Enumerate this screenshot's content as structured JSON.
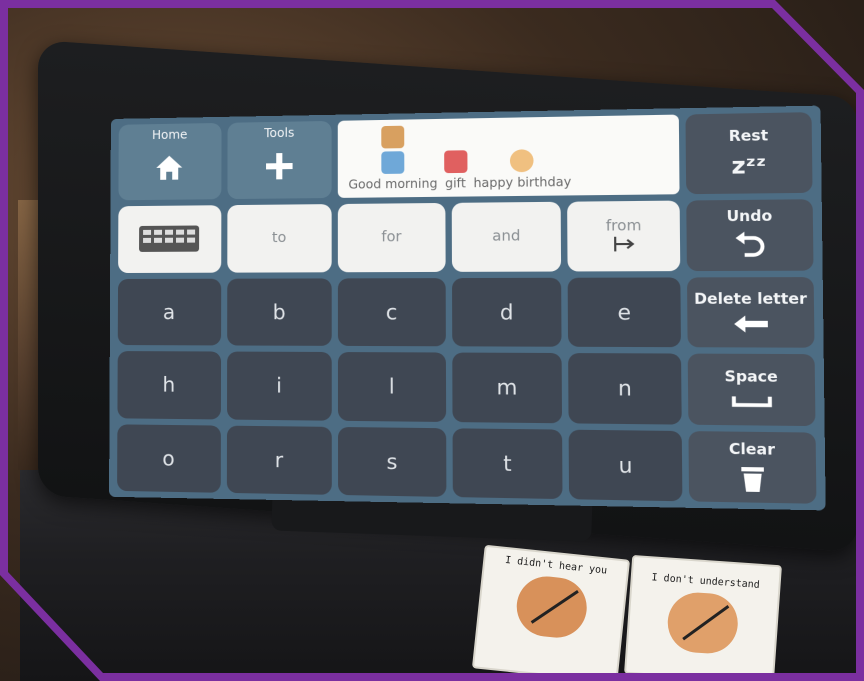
{
  "toolbar": {
    "home_label": "Home",
    "tools_label": "Tools",
    "rest_label": "Rest",
    "rest_icon_text": "zᶻᶻ"
  },
  "message_bar": {
    "items": [
      {
        "label": "Good morning",
        "icon": "thumbs-up-icon"
      },
      {
        "label": "gift",
        "icon": "gift-icon"
      },
      {
        "label": "happy birthday",
        "icon": "face-icon"
      }
    ]
  },
  "words": {
    "keyboard_icon": "keyboard-icon",
    "to": "to",
    "for": "for",
    "and": "and",
    "from": "from"
  },
  "letters": [
    "a",
    "b",
    "c",
    "d",
    "e",
    "h",
    "i",
    "l",
    "m",
    "n",
    "o",
    "r",
    "s",
    "t",
    "u"
  ],
  "controls": {
    "undo": "Undo",
    "delete_letter": "Delete letter",
    "space": "Space",
    "clear": "Clear"
  },
  "cards": {
    "left": "I didn't hear you",
    "right": "I don't understand"
  },
  "colors": {
    "frame": "#7b2fa0",
    "screen": "#4d6d84",
    "word_key": "#f2f2f0",
    "letter_key": "#3f4753"
  }
}
